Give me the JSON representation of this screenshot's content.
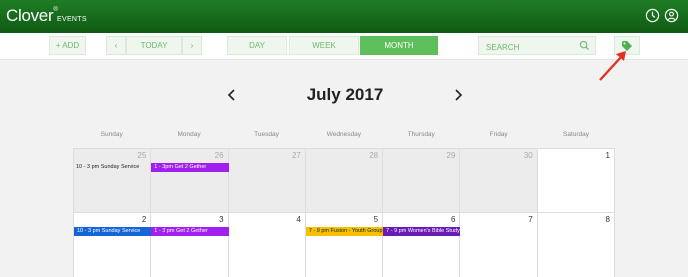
{
  "header": {
    "brand": "Clover",
    "brand_mark": "®",
    "subtitle": "EVENTS"
  },
  "toolbar": {
    "add_label": "+ ADD",
    "prev_label": "‹",
    "today_label": "TODAY",
    "next_label": "›",
    "day_label": "DAY",
    "week_label": "WEEK",
    "month_label": "MONTH",
    "search_placeholder": "SEARCH"
  },
  "calendar": {
    "title": "July 2017",
    "weekdays": [
      "Sunday",
      "Monday",
      "Tuesday",
      "Wednesday",
      "Thursday",
      "Friday",
      "Saturday"
    ],
    "week1": {
      "days": [
        "25",
        "26",
        "27",
        "28",
        "29",
        "30",
        "1"
      ]
    },
    "week2": {
      "days": [
        "2",
        "3",
        "4",
        "5",
        "6",
        "7",
        "8"
      ]
    },
    "events": {
      "w1_sun": "10 - 3 pm Sunday Service",
      "w1_mon": "1 - 3pm Get 2 Gether",
      "w2_sun": "10 - 3 pm Sunday Service",
      "w2_mon": "1 - 3 pm Get 2 Gether",
      "w2_wed": "7 - 9 pm Fusion - Youth Group",
      "w2_thu": "7 - 9 pm Women's Bible Study"
    }
  },
  "colors": {
    "header_green": "#1f7d25",
    "accent_green": "#5cbf5c",
    "event_blue": "#1565d8",
    "event_purple": "#a020f0",
    "event_yellow": "#f5c000",
    "event_violet": "#6a1bb5",
    "annotation_red": "#e53020"
  },
  "icons": [
    "clock-icon",
    "user-icon",
    "search-icon",
    "tag-icon",
    "chevron-left-icon",
    "chevron-right-icon"
  ]
}
